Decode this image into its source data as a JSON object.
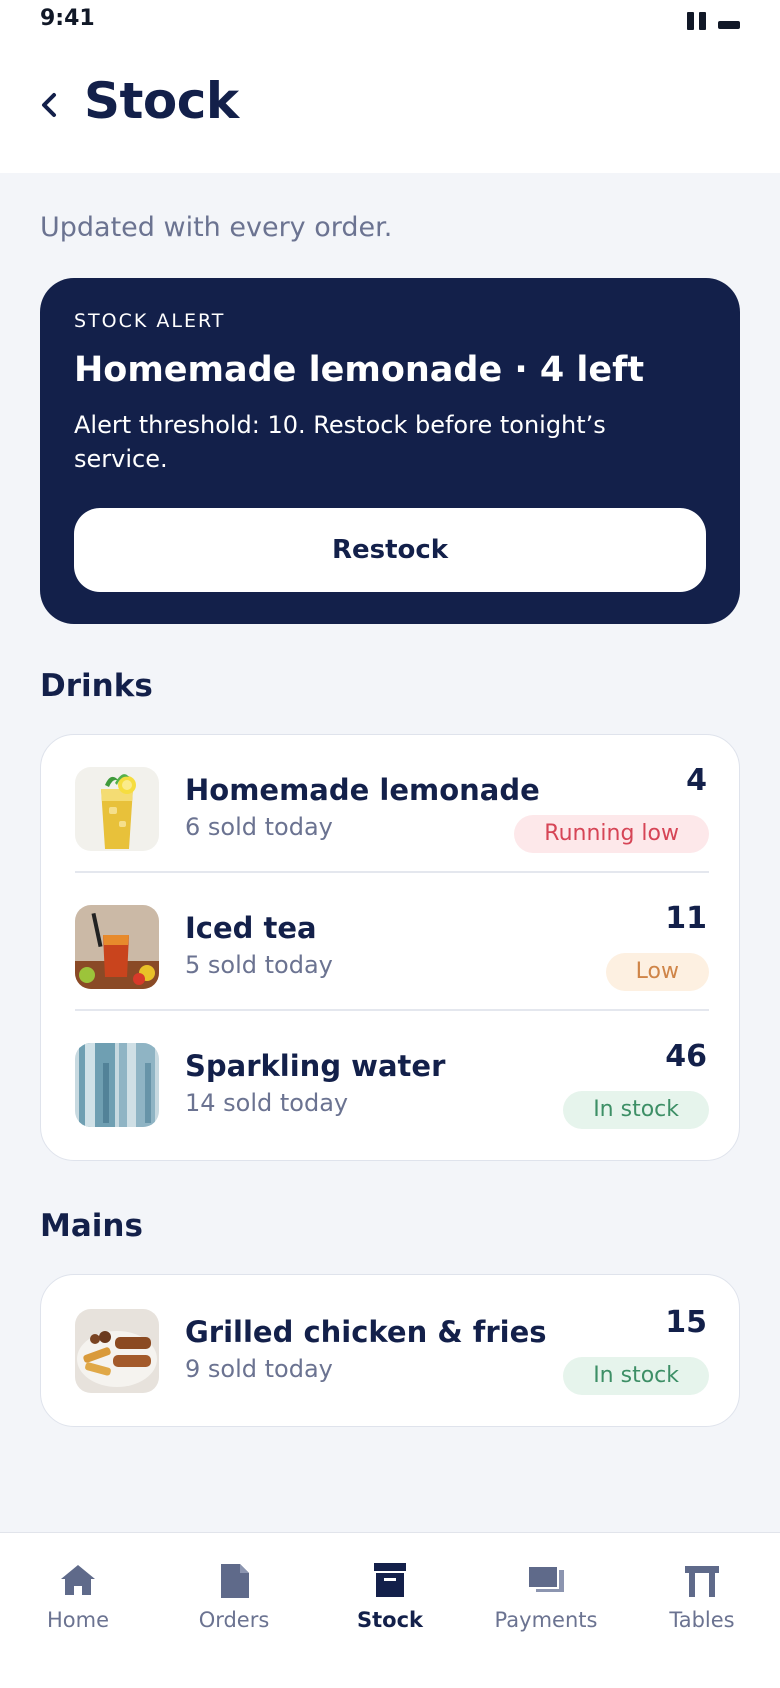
{
  "status_bar": {
    "time": "9:41"
  },
  "header": {
    "title": "Stock"
  },
  "subtitle": "Updated with every order.",
  "alert": {
    "kicker": "STOCK ALERT",
    "title": "Homemade lemonade · 4 left",
    "body": "Alert threshold: 10. Restock before tonight’s service.",
    "button_label": "Restock"
  },
  "sections": [
    {
      "heading": "Drinks",
      "items": [
        {
          "name": "Homemade lemonade",
          "sold": "6 sold today",
          "quantity": "4",
          "status": "Running low",
          "status_color": "#d64556"
        },
        {
          "name": "Iced tea",
          "sold": "5 sold today",
          "quantity": "11",
          "status": "Low",
          "status_color": "#cf8548"
        },
        {
          "name": "Sparkling water",
          "sold": "14 sold today",
          "quantity": "46",
          "status": "In stock",
          "status_color": "#3d8f66"
        }
      ]
    },
    {
      "heading": "Mains",
      "items": [
        {
          "name": "Grilled chicken & fries",
          "sold": "9 sold today",
          "quantity": "15",
          "status": "In stock",
          "status_color": "#3d8f66"
        }
      ]
    }
  ],
  "tabs": [
    {
      "label": "Home",
      "icon": "home-icon"
    },
    {
      "label": "Orders",
      "icon": "document-icon"
    },
    {
      "label": "Stock",
      "icon": "box-icon",
      "active": true
    },
    {
      "label": "Payments",
      "icon": "cards-icon"
    },
    {
      "label": "Tables",
      "icon": "table-icon"
    }
  ],
  "colors": {
    "navy": "#13204a",
    "background": "#f3f5f9",
    "muted": "#6b7391"
  }
}
